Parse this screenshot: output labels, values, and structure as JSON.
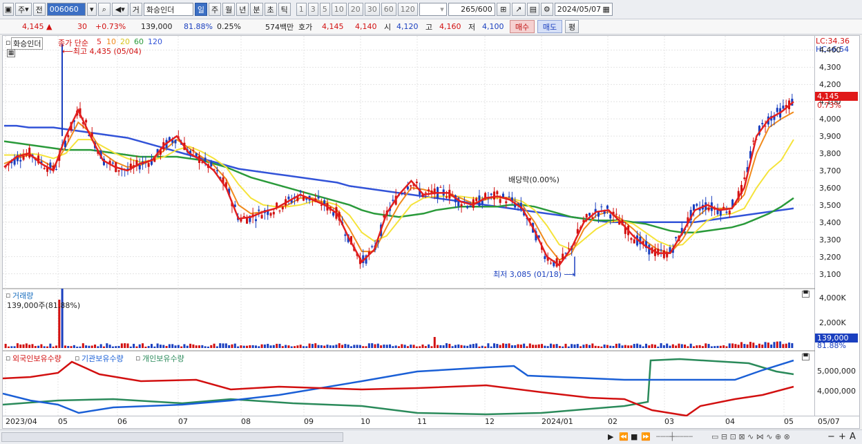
{
  "toolbar": {
    "type_label": "주",
    "prev_label": "전",
    "code": "006060",
    "market_label": "거",
    "name": "화승인더",
    "periods": [
      "일",
      "주",
      "월",
      "년",
      "분",
      "초",
      "틱"
    ],
    "active_period": "일",
    "intervals": [
      "1",
      "3",
      "5",
      "10",
      "20",
      "30",
      "60",
      "120"
    ],
    "count": "265",
    "count_max": "/600",
    "date": "2024/05/07"
  },
  "price_row": {
    "price": "4,145",
    "change": "30",
    "change_pct": "+0.73%",
    "volume": "139,000",
    "vol_ratio": "81.88%",
    "turnover": "0.25%",
    "amount": "574백만",
    "bid_label": "호가",
    "ask": "4,145",
    "bid": "4,140",
    "open_label": "시",
    "open": "4,120",
    "high_label": "고",
    "high": "4,160",
    "low_label": "저",
    "low": "4,100",
    "buy_label": "매수",
    "sell_label": "매도",
    "eval_label": "평"
  },
  "price_panel": {
    "title": "화승인더",
    "ma_label": "종가 단순",
    "ma_periods": [
      "5",
      "10",
      "20",
      "60",
      "120"
    ],
    "high_annotation": "최고 4,435 (05/04)",
    "low_annotation": "최저 3,085 (01/18)",
    "dividend_annotation": "배당락(0.00%)",
    "lc": "LC:34.36",
    "hc": "HC:-6.54",
    "price_tag": "4,145",
    "pct_tag": "0.73%",
    "yticks": [
      "4,400",
      "4,300",
      "4,200",
      "4,100",
      "4,000",
      "3,900",
      "3,800",
      "3,700",
      "3,600",
      "3,500",
      "3,400",
      "3,300",
      "3,200",
      "3,100"
    ]
  },
  "volume_panel": {
    "title": "거래량",
    "value": "139,000주(81.88%)",
    "yticks": [
      "4,000K",
      "2,000K"
    ],
    "tag": "139,000",
    "tag_pct": "81.88%"
  },
  "holdings_panel": {
    "foreign_label": "외국인보유수량",
    "inst_label": "기관보유수량",
    "retail_label": "개인보유수량",
    "yticks": [
      "5,000,000",
      "4,000,000"
    ]
  },
  "x_axis": [
    "2023/04",
    "05",
    "06",
    "07",
    "08",
    "09",
    "10",
    "11",
    "12",
    "2024/01",
    "02",
    "03",
    "04",
    "05",
    "05/07"
  ],
  "colors": {
    "ma5": "#e21f1f",
    "ma10": "#f08a1c",
    "ma20": "#f5e33a",
    "ma60": "#2a9a3a",
    "ma120": "#3253d8",
    "up": "#d21010",
    "down": "#1a3fbf"
  },
  "chart_data": {
    "type": "candlestick",
    "price_range": [
      3050,
      4450
    ],
    "series": [
      {
        "name": "5",
        "values": [
          3720,
          3780,
          3800,
          3740,
          3700,
          3900,
          4050,
          3900,
          3760,
          3720,
          3700,
          3740,
          3760,
          3850,
          3900,
          3800,
          3760,
          3700,
          3600,
          3420,
          3430,
          3460,
          3480,
          3520,
          3560,
          3530,
          3500,
          3450,
          3300,
          3170,
          3240,
          3450,
          3560,
          3640,
          3560,
          3570,
          3570,
          3520,
          3500,
          3540,
          3550,
          3530,
          3480,
          3350,
          3200,
          3150,
          3250,
          3400,
          3460,
          3470,
          3400,
          3320,
          3260,
          3220,
          3220,
          3340,
          3470,
          3500,
          3470,
          3480,
          3600,
          3900,
          4000,
          4040,
          4100
        ]
      },
      {
        "name": "10",
        "values": [
          3740,
          3770,
          3790,
          3760,
          3720,
          3840,
          3980,
          3920,
          3800,
          3750,
          3720,
          3730,
          3760,
          3820,
          3880,
          3830,
          3780,
          3730,
          3650,
          3500,
          3450,
          3460,
          3480,
          3500,
          3540,
          3540,
          3510,
          3470,
          3360,
          3230,
          3230,
          3370,
          3500,
          3600,
          3590,
          3570,
          3570,
          3540,
          3510,
          3530,
          3550,
          3540,
          3500,
          3400,
          3270,
          3180,
          3220,
          3360,
          3440,
          3460,
          3420,
          3360,
          3290,
          3240,
          3220,
          3300,
          3420,
          3480,
          3480,
          3480,
          3560,
          3800,
          3950,
          4000,
          4040
        ]
      },
      {
        "name": "20",
        "values": [
          3790,
          3790,
          3800,
          3790,
          3770,
          3800,
          3880,
          3880,
          3840,
          3800,
          3770,
          3750,
          3760,
          3780,
          3820,
          3840,
          3810,
          3770,
          3720,
          3620,
          3540,
          3500,
          3490,
          3490,
          3500,
          3520,
          3520,
          3500,
          3440,
          3340,
          3290,
          3320,
          3410,
          3500,
          3540,
          3550,
          3550,
          3550,
          3540,
          3540,
          3540,
          3540,
          3520,
          3470,
          3380,
          3270,
          3240,
          3300,
          3360,
          3400,
          3410,
          3390,
          3340,
          3290,
          3260,
          3270,
          3340,
          3410,
          3440,
          3450,
          3480,
          3600,
          3700,
          3760,
          3880
        ]
      },
      {
        "name": "60",
        "values": [
          3870,
          3860,
          3850,
          3840,
          3830,
          3820,
          3820,
          3820,
          3810,
          3800,
          3790,
          3780,
          3780,
          3780,
          3780,
          3770,
          3760,
          3740,
          3720,
          3690,
          3660,
          3640,
          3620,
          3600,
          3580,
          3560,
          3540,
          3520,
          3500,
          3470,
          3450,
          3440,
          3430,
          3440,
          3450,
          3470,
          3480,
          3490,
          3490,
          3490,
          3490,
          3500,
          3500,
          3490,
          3470,
          3450,
          3430,
          3420,
          3410,
          3410,
          3410,
          3400,
          3390,
          3370,
          3350,
          3340,
          3340,
          3350,
          3360,
          3370,
          3390,
          3420,
          3450,
          3490,
          3540
        ]
      },
      {
        "name": "120",
        "values": [
          3960,
          3960,
          3950,
          3950,
          3950,
          3940,
          3930,
          3920,
          3910,
          3900,
          3890,
          3870,
          3850,
          3830,
          3810,
          3790,
          3770,
          3750,
          3730,
          3710,
          3700,
          3690,
          3680,
          3670,
          3660,
          3650,
          3640,
          3630,
          3610,
          3600,
          3590,
          3580,
          3570,
          3560,
          3550,
          3540,
          3530,
          3520,
          3510,
          3500,
          3490,
          3480,
          3470,
          3460,
          3450,
          3440,
          3430,
          3420,
          3410,
          3400,
          3400,
          3400,
          3400,
          3400,
          3400,
          3400,
          3400,
          3410,
          3420,
          3430,
          3440,
          3450,
          3460,
          3470,
          3480
        ]
      }
    ]
  }
}
